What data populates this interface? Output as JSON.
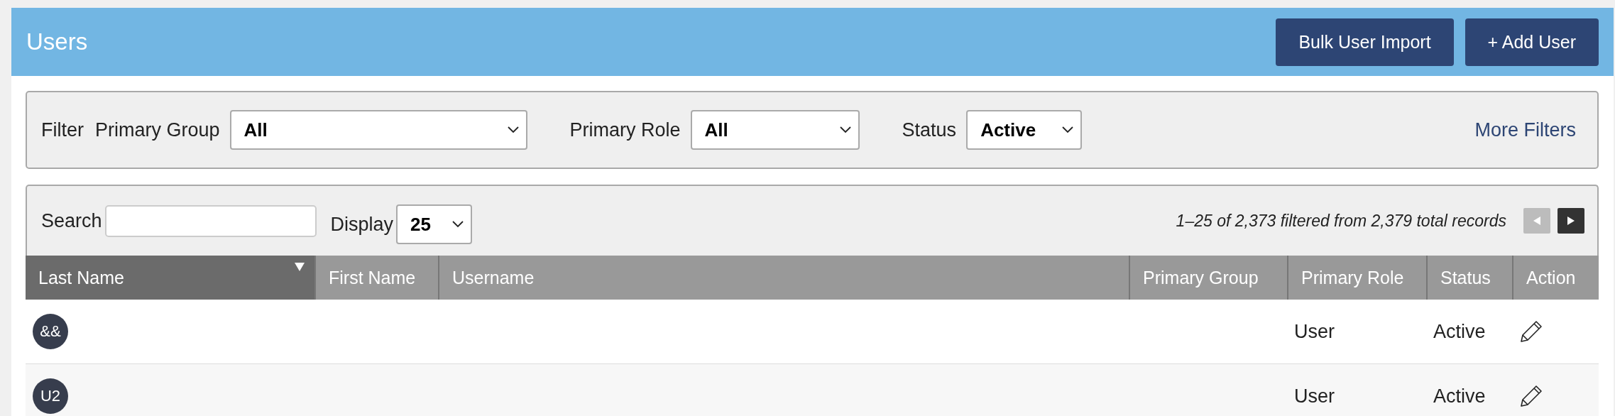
{
  "header": {
    "title": "Users",
    "buttons": [
      {
        "label": "Bulk User Import"
      },
      {
        "label": "+ Add User"
      }
    ]
  },
  "filter": {
    "label": "Filter",
    "fields": [
      {
        "label": "Primary Group",
        "value": "All"
      },
      {
        "label": "Primary Role",
        "value": "All"
      },
      {
        "label": "Status",
        "value": "Active"
      }
    ],
    "more_link": "More Filters"
  },
  "toolbar": {
    "search_label": "Search",
    "display_label": "Display",
    "display_value": "25",
    "records": "1–25 of 2,373 filtered from 2,379 total records",
    "prev_disabled": true,
    "next_disabled": false
  },
  "table": {
    "columns": [
      {
        "label": "Last Name",
        "sorted": true
      },
      {
        "label": "First Name",
        "sorted": false
      },
      {
        "label": "Username",
        "sorted": false
      },
      {
        "label": "Primary Group",
        "sorted": false
      },
      {
        "label": "Primary Role",
        "sorted": false
      },
      {
        "label": "Status",
        "sorted": false
      },
      {
        "label": "Action",
        "sorted": false
      }
    ],
    "rows": [
      {
        "initials": "&&",
        "role": "User",
        "status": "Active"
      },
      {
        "initials": "U2",
        "role": "User",
        "status": "Active"
      }
    ]
  }
}
